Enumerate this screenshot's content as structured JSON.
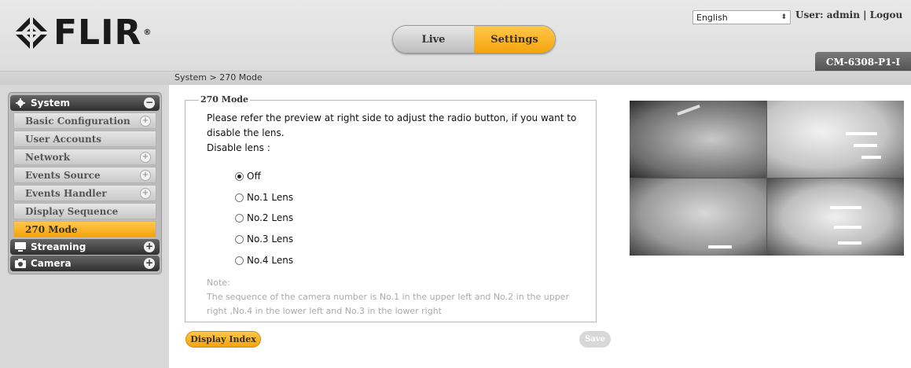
{
  "brand": {
    "name": "FLIR",
    "reg": "®"
  },
  "header": {
    "tabs": {
      "live": "Live",
      "settings": "Settings",
      "active": "Settings"
    },
    "language": {
      "selected": "English"
    },
    "user_label": "User: admin | Logou",
    "model": "CM-6308-P1-I"
  },
  "breadcrumb": "System > 270 Mode",
  "sidebar": {
    "groups": [
      {
        "label": "System",
        "icon": "gear-icon",
        "toggle": "−",
        "expanded": true
      },
      {
        "label": "Streaming",
        "icon": "monitor-icon",
        "toggle": "+",
        "expanded": false
      },
      {
        "label": "Camera",
        "icon": "camera-icon",
        "toggle": "+",
        "expanded": false
      }
    ],
    "system_items": [
      {
        "label": "Basic Configuration",
        "has_sub": true
      },
      {
        "label": "User Accounts",
        "has_sub": false
      },
      {
        "label": "Network",
        "has_sub": true
      },
      {
        "label": "Events Source",
        "has_sub": true
      },
      {
        "label": "Events Handler",
        "has_sub": true
      },
      {
        "label": "Display Sequence",
        "has_sub": false
      },
      {
        "label": "270 Mode",
        "has_sub": false,
        "active": true
      }
    ]
  },
  "panel": {
    "title": "270 Mode",
    "description": "Please refer the preview at right side to adjust the radio button, if you want to disable the lens.",
    "disable_label": "Disable lens :",
    "options": [
      "Off",
      "No.1 Lens",
      "No.2 Lens",
      "No.3 Lens",
      "No.4 Lens"
    ],
    "selected": "Off",
    "note_title": "Note:",
    "note_text": "The sequence of the camera number is No.1 in the upper left and No.2 in the upper right ,No.4 in the lower left and No.3 in the lower right"
  },
  "buttons": {
    "display_index": "Display Index",
    "save": "Save"
  },
  "colors": {
    "accent": "#f5a30e",
    "nav_dark": "#3a3a3a"
  }
}
